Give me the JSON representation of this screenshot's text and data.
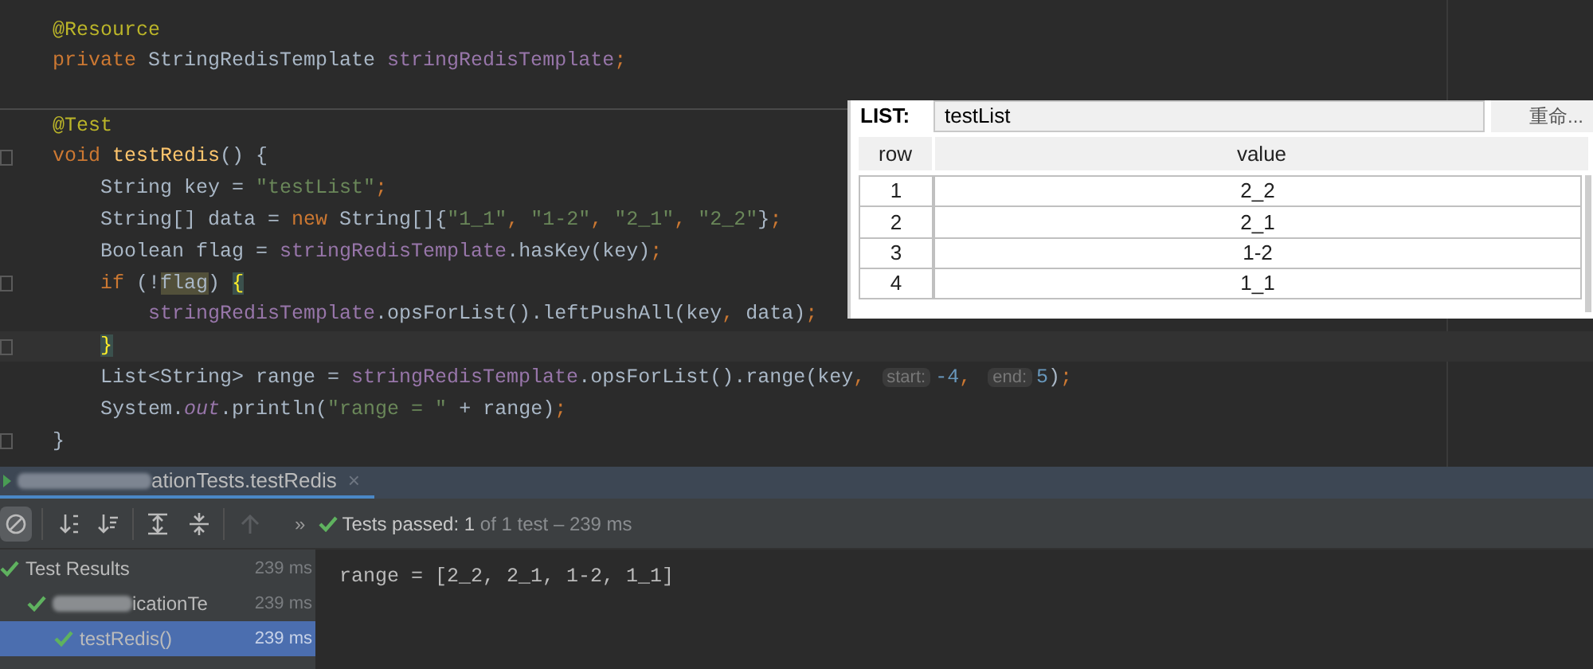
{
  "editor": {
    "sections": [
      {
        "lines": [
          {
            "fold_marker": false,
            "current": false,
            "tokens": [
              {
                "kind": "annotation",
                "text": "@Resource"
              }
            ]
          },
          {
            "fold_marker": false,
            "current": false,
            "tokens": [
              {
                "kind": "keyword",
                "text": "private "
              },
              {
                "kind": "plain",
                "text": "StringRedisTemplate "
              },
              {
                "kind": "field",
                "text": "stringRedisTemplate"
              },
              {
                "kind": "keyword",
                "text": ";"
              }
            ]
          }
        ]
      },
      {
        "lines": [
          {
            "fold_marker": false,
            "current": false,
            "tokens": [
              {
                "kind": "annotation",
                "text": "@Test"
              }
            ]
          },
          {
            "fold_marker": true,
            "current": false,
            "tokens": [
              {
                "kind": "keyword",
                "text": "void "
              },
              {
                "kind": "method",
                "text": "testRedis"
              },
              {
                "kind": "plain",
                "text": "() {"
              }
            ]
          },
          {
            "fold_marker": false,
            "current": false,
            "tokens": [
              {
                "kind": "plain",
                "text": "    String key = "
              },
              {
                "kind": "string",
                "text": "\"testList\""
              },
              {
                "kind": "keyword",
                "text": ";"
              }
            ]
          },
          {
            "fold_marker": false,
            "current": false,
            "tokens": [
              {
                "kind": "plain",
                "text": "    String[] data = "
              },
              {
                "kind": "keyword",
                "text": "new "
              },
              {
                "kind": "plain",
                "text": "String[]{"
              },
              {
                "kind": "string",
                "text": "\"1_1\""
              },
              {
                "kind": "keyword",
                "text": ", "
              },
              {
                "kind": "string",
                "text": "\"1-2\""
              },
              {
                "kind": "keyword",
                "text": ", "
              },
              {
                "kind": "string",
                "text": "\"2_1\""
              },
              {
                "kind": "keyword",
                "text": ", "
              },
              {
                "kind": "string",
                "text": "\"2_2\""
              },
              {
                "kind": "plain",
                "text": "}"
              },
              {
                "kind": "keyword",
                "text": ";"
              }
            ]
          },
          {
            "fold_marker": false,
            "current": false,
            "tokens": [
              {
                "kind": "plain",
                "text": "    Boolean flag = "
              },
              {
                "kind": "field",
                "text": "stringRedisTemplate"
              },
              {
                "kind": "plain",
                "text": ".hasKey(key)"
              },
              {
                "kind": "keyword",
                "text": ";"
              }
            ]
          },
          {
            "fold_marker": true,
            "current": false,
            "tokens": [
              {
                "kind": "keyword",
                "text": "    if "
              },
              {
                "kind": "plain",
                "text": "(!"
              },
              {
                "kind": "occurrence",
                "text": "flag"
              },
              {
                "kind": "plain",
                "text": ") "
              },
              {
                "kind": "brace_match",
                "text": "{"
              }
            ]
          },
          {
            "fold_marker": false,
            "current": false,
            "tokens": [
              {
                "kind": "field",
                "text": "        stringRedisTemplate"
              },
              {
                "kind": "plain",
                "text": ".opsForList().leftPushAll(key"
              },
              {
                "kind": "keyword",
                "text": ", "
              },
              {
                "kind": "plain",
                "text": "data)"
              },
              {
                "kind": "keyword",
                "text": ";"
              }
            ]
          },
          {
            "fold_marker": true,
            "current": true,
            "tokens": [
              {
                "kind": "brace_match",
                "text": "    }"
              }
            ]
          },
          {
            "fold_marker": false,
            "current": false,
            "tokens": [
              {
                "kind": "plain",
                "text": "    List<String> range = "
              },
              {
                "kind": "field",
                "text": "stringRedisTemplate"
              },
              {
                "kind": "plain",
                "text": ".opsForList().range(key"
              },
              {
                "kind": "keyword",
                "text": ", "
              },
              {
                "kind": "hint",
                "text": "start:"
              },
              {
                "kind": "number",
                "text": "-4"
              },
              {
                "kind": "keyword",
                "text": ", "
              },
              {
                "kind": "hint",
                "text": "end:"
              },
              {
                "kind": "number",
                "text": "5"
              },
              {
                "kind": "plain",
                "text": ")"
              },
              {
                "kind": "keyword",
                "text": ";"
              }
            ]
          },
          {
            "fold_marker": false,
            "current": false,
            "tokens": [
              {
                "kind": "plain",
                "text": "    System."
              },
              {
                "kind": "static",
                "text": "out"
              },
              {
                "kind": "plain",
                "text": ".println("
              },
              {
                "kind": "string",
                "text": "\"range = \""
              },
              {
                "kind": "plain",
                "text": " + range)"
              },
              {
                "kind": "keyword",
                "text": ";"
              }
            ]
          },
          {
            "fold_marker": true,
            "current": false,
            "tokens": [
              {
                "kind": "plain",
                "text": "}"
              }
            ]
          }
        ]
      }
    ]
  },
  "redis_panel": {
    "label": "LIST:",
    "key_field": "testList",
    "rename_button": "重命...",
    "columns": [
      "row",
      "value"
    ],
    "rows": [
      [
        "1",
        "2_2"
      ],
      [
        "2",
        "2_1"
      ],
      [
        "3",
        "1-2"
      ],
      [
        "4",
        "1_1"
      ]
    ]
  },
  "run_panel": {
    "tab": {
      "title": "ationTests.testRedis",
      "close": "×"
    },
    "toolbar": {
      "more": "»",
      "status": "**Tests passed: 1** of 1 test – 239 ms"
    },
    "tree": [
      {
        "label": "Test Results",
        "time": "239 ms",
        "selected": false,
        "children": [
          {
            "label": "icationTe",
            "time": "239 ms",
            "selected": false,
            "children": [
              {
                "label": "testRedis()",
                "time": "239 ms",
                "selected": true
              }
            ]
          }
        ]
      }
    ],
    "console": "range = [2_2, 2_1, 1-2, 1_1]"
  }
}
